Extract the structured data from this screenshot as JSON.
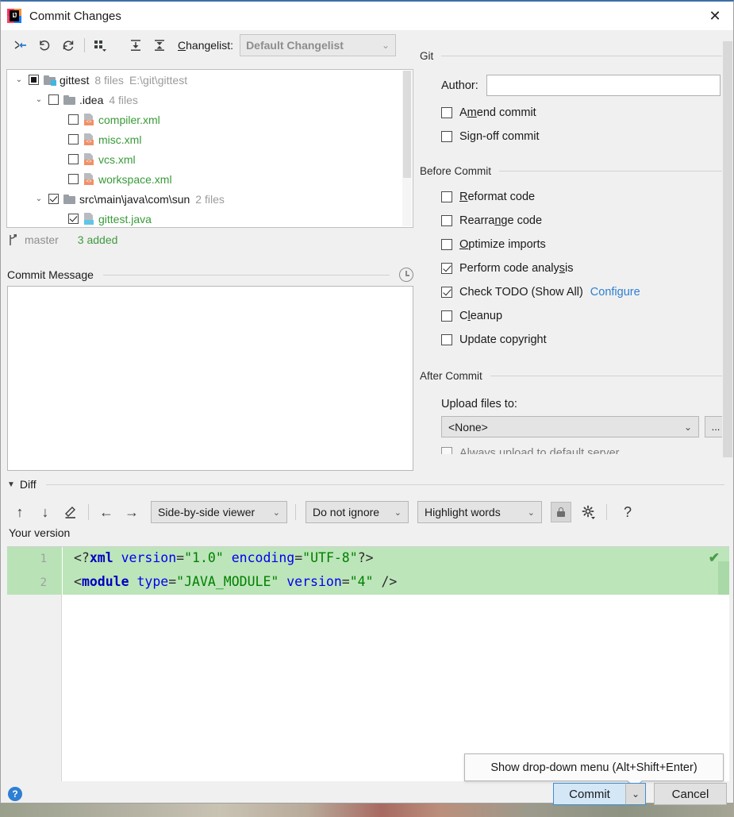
{
  "window": {
    "title": "Commit Changes",
    "app_icon": "intellij-idea-logo",
    "close_icon": "✕"
  },
  "toolbar": {
    "icons": [
      {
        "name": "move-to-another-changelist-icon",
        "glyph": "⇥"
      },
      {
        "name": "rollback-icon",
        "glyph": "↺"
      },
      {
        "name": "refresh-icon",
        "glyph": "⟳"
      },
      {
        "name": "group-by-icon",
        "glyph": "⸬"
      },
      {
        "name": "expand-all-icon",
        "glyph": "⤓"
      },
      {
        "name": "collapse-all-icon",
        "glyph": "⤒"
      }
    ],
    "changelist_label": "Changelist:",
    "changelist_mnemonic": "C",
    "changelist_value": "Default Changelist",
    "chevron": "⌄"
  },
  "tree": {
    "rows": [
      {
        "indent": 0,
        "twisty": "⌄",
        "check": "partial",
        "icon": "folder-vcs-icon",
        "name": "gittest",
        "name_color": "dark",
        "meta": "8 files",
        "path": "E:\\git\\gittest"
      },
      {
        "indent": 1,
        "twisty": "⌄",
        "check": "unchecked",
        "icon": "folder-icon",
        "name": ".idea",
        "name_color": "dark",
        "meta": "4 files",
        "path": ""
      },
      {
        "indent": 2,
        "twisty": "",
        "check": "unchecked",
        "icon": "xml-file-icon",
        "name": "compiler.xml",
        "name_color": "green",
        "meta": "",
        "path": ""
      },
      {
        "indent": 2,
        "twisty": "",
        "check": "unchecked",
        "icon": "xml-file-icon",
        "name": "misc.xml",
        "name_color": "green",
        "meta": "",
        "path": ""
      },
      {
        "indent": 2,
        "twisty": "",
        "check": "unchecked",
        "icon": "xml-file-icon",
        "name": "vcs.xml",
        "name_color": "green",
        "meta": "",
        "path": ""
      },
      {
        "indent": 2,
        "twisty": "",
        "check": "unchecked",
        "icon": "xml-file-icon",
        "name": "workspace.xml",
        "name_color": "green",
        "meta": "",
        "path": ""
      },
      {
        "indent": 1,
        "twisty": "⌄",
        "check": "checked",
        "icon": "folder-icon",
        "name": "src\\main\\java\\com\\sun",
        "name_color": "dark",
        "meta": "2 files",
        "path": ""
      },
      {
        "indent": 2,
        "twisty": "",
        "check": "checked",
        "icon": "java-file-icon",
        "name": "gittest.java",
        "name_color": "green",
        "meta": "",
        "path": ""
      }
    ]
  },
  "status": {
    "branch_icon": "branch-icon",
    "branch": "master",
    "added": "3 added"
  },
  "commit_message": {
    "label": "Commit Message",
    "history_icon": "clock-history-icon",
    "value": "",
    "placeholder": ""
  },
  "options": {
    "git_section": "Git",
    "author_label": "Author:",
    "author_value": "",
    "git_checks": [
      {
        "name": "amend-commit",
        "pre": "A",
        "mn": "m",
        "post": "end commit",
        "checked": false
      },
      {
        "name": "sign-off-commit",
        "pre": "Si",
        "mn": "g",
        "post": "n-off commit",
        "checked": false
      }
    ],
    "before_section": "Before Commit",
    "before_checks": [
      {
        "name": "reformat-code",
        "pre": "",
        "mn": "R",
        "post": "eformat code",
        "checked": false,
        "link": ""
      },
      {
        "name": "rearrange-code",
        "pre": "Rearra",
        "mn": "n",
        "post": "ge code",
        "checked": false,
        "link": ""
      },
      {
        "name": "optimize-imports",
        "pre": "",
        "mn": "O",
        "post": "ptimize imports",
        "checked": false,
        "link": ""
      },
      {
        "name": "perform-code-analysis",
        "pre": "Perform code analy",
        "mn": "s",
        "post": "is",
        "checked": true,
        "link": ""
      },
      {
        "name": "check-todo",
        "pre": "Check TODO (Show All)",
        "mn": "",
        "post": "",
        "checked": true,
        "link": "Configure"
      },
      {
        "name": "cleanup",
        "pre": "C",
        "mn": "l",
        "post": "eanup",
        "checked": false,
        "link": ""
      },
      {
        "name": "update-copyright",
        "pre": "Update copyright",
        "mn": "",
        "post": "",
        "checked": false,
        "link": ""
      }
    ],
    "after_section": "After Commit",
    "upload_label": "Upload files to:",
    "upload_value": "<None>",
    "upload_chevron": "⌄",
    "browse_label": "...",
    "clipped_row_text": "Always upload to default server"
  },
  "diff": {
    "section_label": "Diff",
    "collapse_icon": "▼",
    "toolbar": {
      "prev_diff_icon": "↑",
      "next_diff_icon": "↓",
      "edit_icon": "✎",
      "accept_left_icon": "←",
      "accept_right_icon": "→",
      "viewer_mode": "Side-by-side viewer",
      "whitespace_mode": "Do not ignore",
      "highlight_mode": "Highlight words",
      "lock_icon": "lock-icon",
      "settings_icon": "gear-icon",
      "help_icon": "?"
    },
    "version_label": "Your version",
    "ok_check_icon": "✔",
    "lines": [
      {
        "number": "1",
        "tokens": [
          {
            "t": "<?",
            "c": "punct"
          },
          {
            "t": "xml",
            "c": "tag"
          },
          {
            "t": " ",
            "c": "punct"
          },
          {
            "t": "version",
            "c": "attr"
          },
          {
            "t": "=",
            "c": "punct"
          },
          {
            "t": "\"1.0\"",
            "c": "val"
          },
          {
            "t": " ",
            "c": "punct"
          },
          {
            "t": "encoding",
            "c": "attr"
          },
          {
            "t": "=",
            "c": "punct"
          },
          {
            "t": "\"UTF-8\"",
            "c": "val"
          },
          {
            "t": "?>",
            "c": "punct"
          }
        ]
      },
      {
        "number": "2",
        "tokens": [
          {
            "t": "<",
            "c": "punct"
          },
          {
            "t": "module",
            "c": "tag"
          },
          {
            "t": " ",
            "c": "punct"
          },
          {
            "t": "type",
            "c": "attr"
          },
          {
            "t": "=",
            "c": "punct"
          },
          {
            "t": "\"JAVA_MODULE\"",
            "c": "val"
          },
          {
            "t": " ",
            "c": "punct"
          },
          {
            "t": "version",
            "c": "attr"
          },
          {
            "t": "=",
            "c": "punct"
          },
          {
            "t": "\"4\"",
            "c": "val"
          },
          {
            "t": " />",
            "c": "punct"
          }
        ]
      }
    ]
  },
  "footer": {
    "help_label": "?",
    "commit_label": "Commit",
    "commit_dropdown_chevron": "⌄",
    "cancel_label": "Cancel",
    "tooltip": "Show drop-down menu (Alt+Shift+Enter)"
  },
  "colors": {
    "accent": "#2f7fd0",
    "added_green": "#3f9a3f",
    "diff_added_bg": "#bde5ba",
    "commit_button_bg": "#d3e7f7",
    "file_green": "#389a38"
  }
}
